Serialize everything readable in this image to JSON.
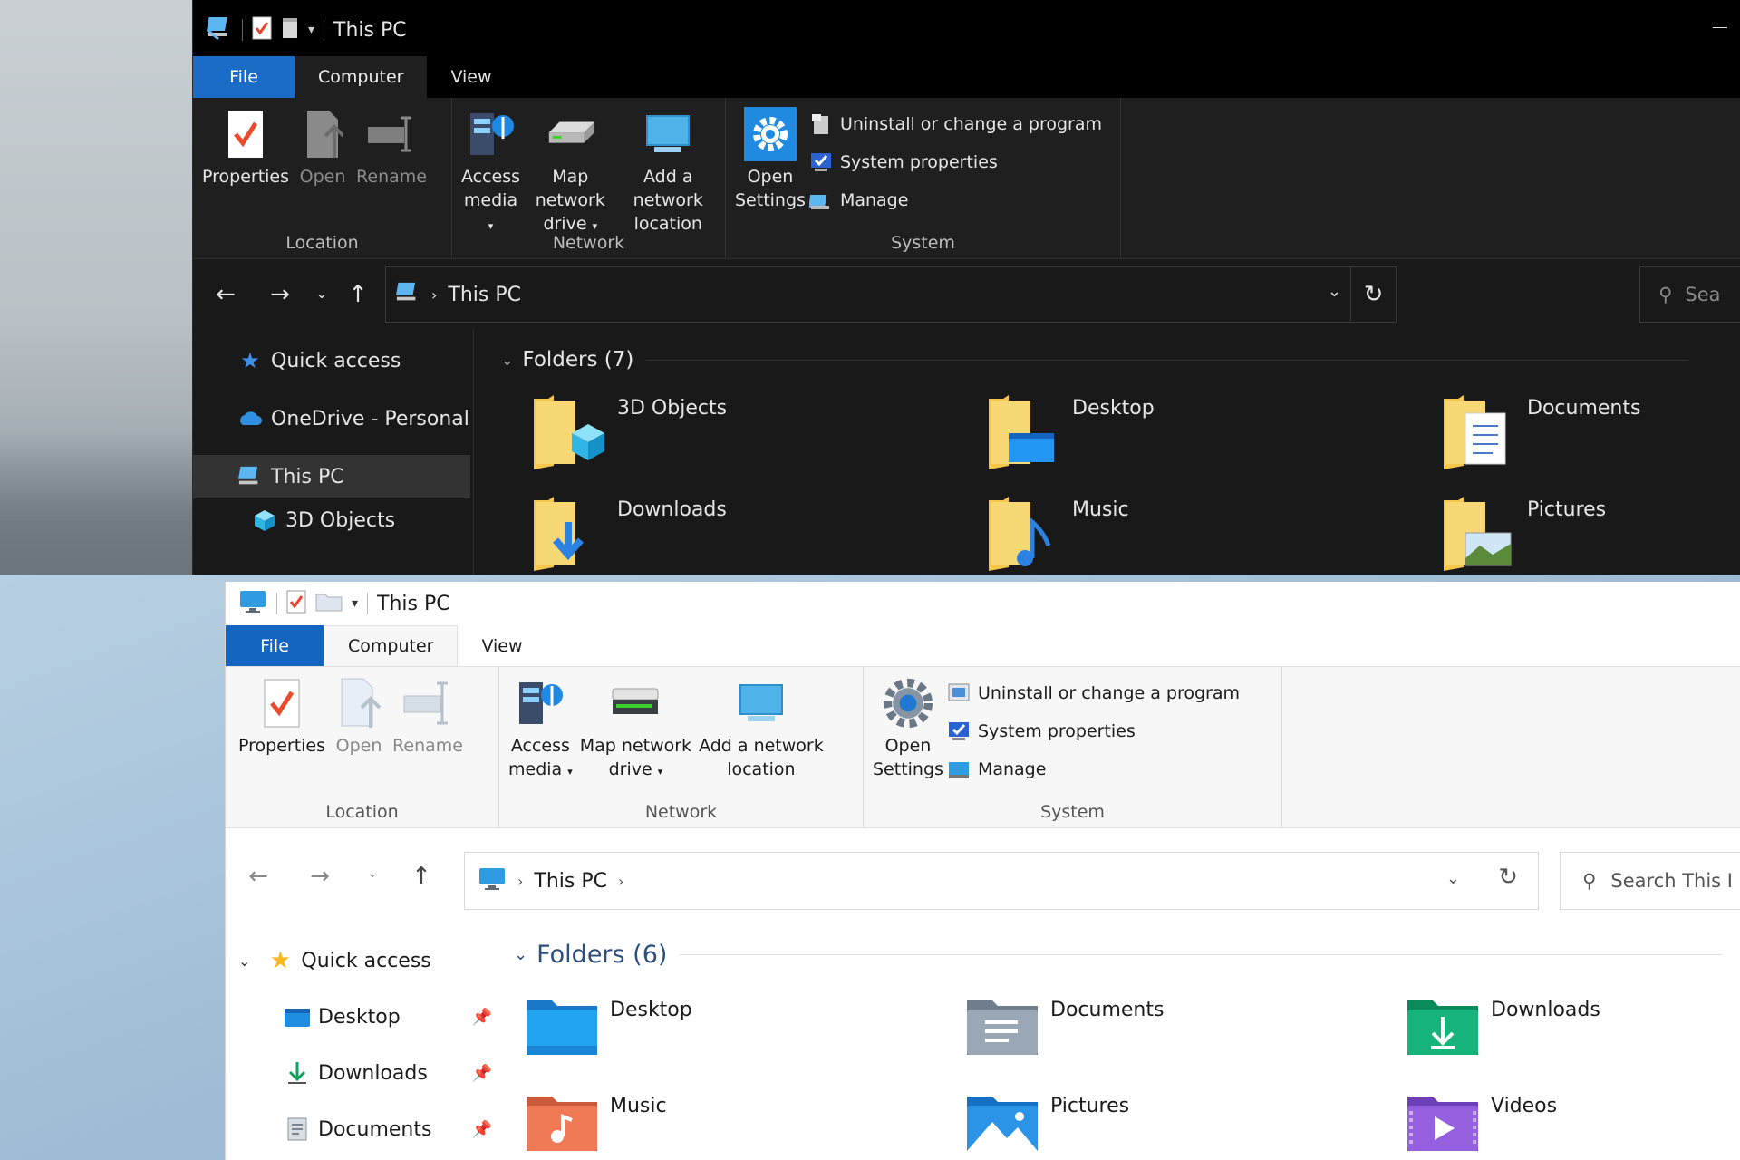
{
  "top_window": {
    "title": "This PC",
    "tabs": {
      "file": "File",
      "computer": "Computer",
      "view": "View"
    },
    "ribbon": {
      "location": {
        "label": "Location",
        "properties": "Properties",
        "open": "Open",
        "rename": "Rename"
      },
      "network": {
        "label": "Network",
        "access_media_1": "Access",
        "access_media_2": "media",
        "map_drive_1": "Map network",
        "map_drive_2": "drive",
        "add_location_1": "Add a network",
        "add_location_2": "location"
      },
      "system": {
        "label": "System",
        "open_settings_1": "Open",
        "open_settings_2": "Settings",
        "uninstall": "Uninstall or change a program",
        "system_properties": "System properties",
        "manage": "Manage"
      }
    },
    "address": {
      "location": "This PC",
      "search_placeholder": "Sea"
    },
    "nav": [
      {
        "label": "Quick access"
      },
      {
        "label": "OneDrive - Personal"
      },
      {
        "label": "This PC"
      },
      {
        "label": "3D Objects"
      }
    ],
    "section": "Folders (7)",
    "folders": [
      {
        "label": "3D Objects"
      },
      {
        "label": "Desktop"
      },
      {
        "label": "Documents"
      },
      {
        "label": "Downloads"
      },
      {
        "label": "Music"
      },
      {
        "label": "Pictures"
      }
    ]
  },
  "bottom_window": {
    "title": "This PC",
    "tabs": {
      "file": "File",
      "computer": "Computer",
      "view": "View"
    },
    "ribbon": {
      "location": {
        "label": "Location",
        "properties": "Properties",
        "open": "Open",
        "rename": "Rename"
      },
      "network": {
        "label": "Network",
        "access_media_1": "Access",
        "access_media_2": "media",
        "map_drive_1": "Map network",
        "map_drive_2": "drive",
        "add_location_1": "Add a network",
        "add_location_2": "location"
      },
      "system": {
        "label": "System",
        "open_settings_1": "Open",
        "open_settings_2": "Settings",
        "uninstall": "Uninstall or change a program",
        "system_properties": "System properties",
        "manage": "Manage"
      }
    },
    "address": {
      "location": "This PC",
      "search_placeholder": "Search This I"
    },
    "nav": [
      {
        "label": "Quick access"
      },
      {
        "label": "Desktop"
      },
      {
        "label": "Downloads"
      },
      {
        "label": "Documents"
      }
    ],
    "section": "Folders (6)",
    "folders": [
      {
        "label": "Desktop"
      },
      {
        "label": "Documents"
      },
      {
        "label": "Downloads"
      },
      {
        "label": "Music"
      },
      {
        "label": "Pictures"
      },
      {
        "label": "Videos"
      }
    ]
  },
  "colors": {
    "file_tab_blue": "#1a6cc7",
    "folder_yellow": "#f4c64b",
    "accent_blue": "#1f8ae0"
  }
}
